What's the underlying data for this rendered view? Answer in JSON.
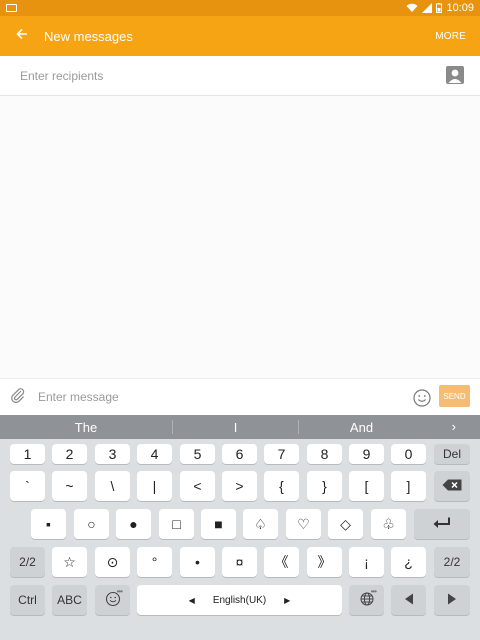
{
  "status": {
    "time": "10:09"
  },
  "appbar": {
    "title": "New messages",
    "more_label": "MORE"
  },
  "recipients": {
    "placeholder": "Enter recipients"
  },
  "composer": {
    "placeholder": "Enter message",
    "send_label": "SEND"
  },
  "suggestions": [
    "The",
    "I",
    "And"
  ],
  "keyboard": {
    "row1": [
      "1",
      "2",
      "3",
      "4",
      "5",
      "6",
      "7",
      "8",
      "9",
      "0"
    ],
    "row1_del": "Del",
    "row2": [
      "`",
      "~",
      "\\",
      "|",
      "<",
      ">",
      "{",
      "}",
      "[",
      "]"
    ],
    "row3": [
      "▪",
      "○",
      "●",
      "□",
      "■",
      "♤",
      "♡",
      "◇",
      "♧"
    ],
    "row4_page": "2/2",
    "row4": [
      "☆",
      "⊙",
      "°",
      "•",
      "¤",
      "《",
      "》",
      "¡",
      "¿"
    ],
    "row4_page_right": "2/2",
    "ctrl_label": "Ctrl",
    "abc_label": "ABC",
    "language_label": "English(UK)"
  },
  "colors": {
    "statusbar": "#e8930f",
    "appbar": "#f7a414",
    "send": "#f6bc72",
    "keyboard_bg": "#dcdfe1"
  }
}
